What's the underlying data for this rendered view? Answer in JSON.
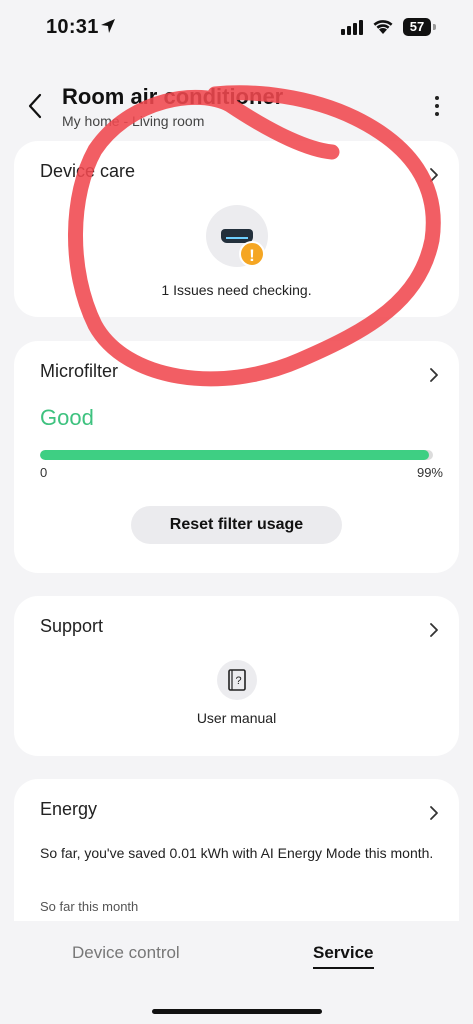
{
  "status": {
    "time": "10:31",
    "battery": "57"
  },
  "header": {
    "title": "Room air conditioner",
    "subtitle": "My home - Living room"
  },
  "device_care": {
    "title": "Device care",
    "message": "1 Issues need checking.",
    "warning_symbol": "!",
    "icons": [
      "air-conditioner-icon",
      "warning-icon"
    ]
  },
  "microfilter": {
    "title": "Microfilter",
    "status": "Good",
    "usage_percent": 99,
    "min_label": "0",
    "max_label": "99%",
    "reset_label": "Reset filter usage"
  },
  "support": {
    "title": "Support",
    "manual_label": "User manual",
    "icon": "user-manual-icon"
  },
  "energy": {
    "title": "Energy",
    "text": "So far, you've saved 0.01 kWh with AI Energy Mode this month.",
    "subtext": "So far this month"
  },
  "nav": {
    "device_control": "Device control",
    "service": "Service",
    "active": "service"
  },
  "colors": {
    "accent_green": "#3ecf83",
    "good_text": "#3ec27f",
    "warning": "#f5a623",
    "annotation_red": "#f0484f"
  }
}
